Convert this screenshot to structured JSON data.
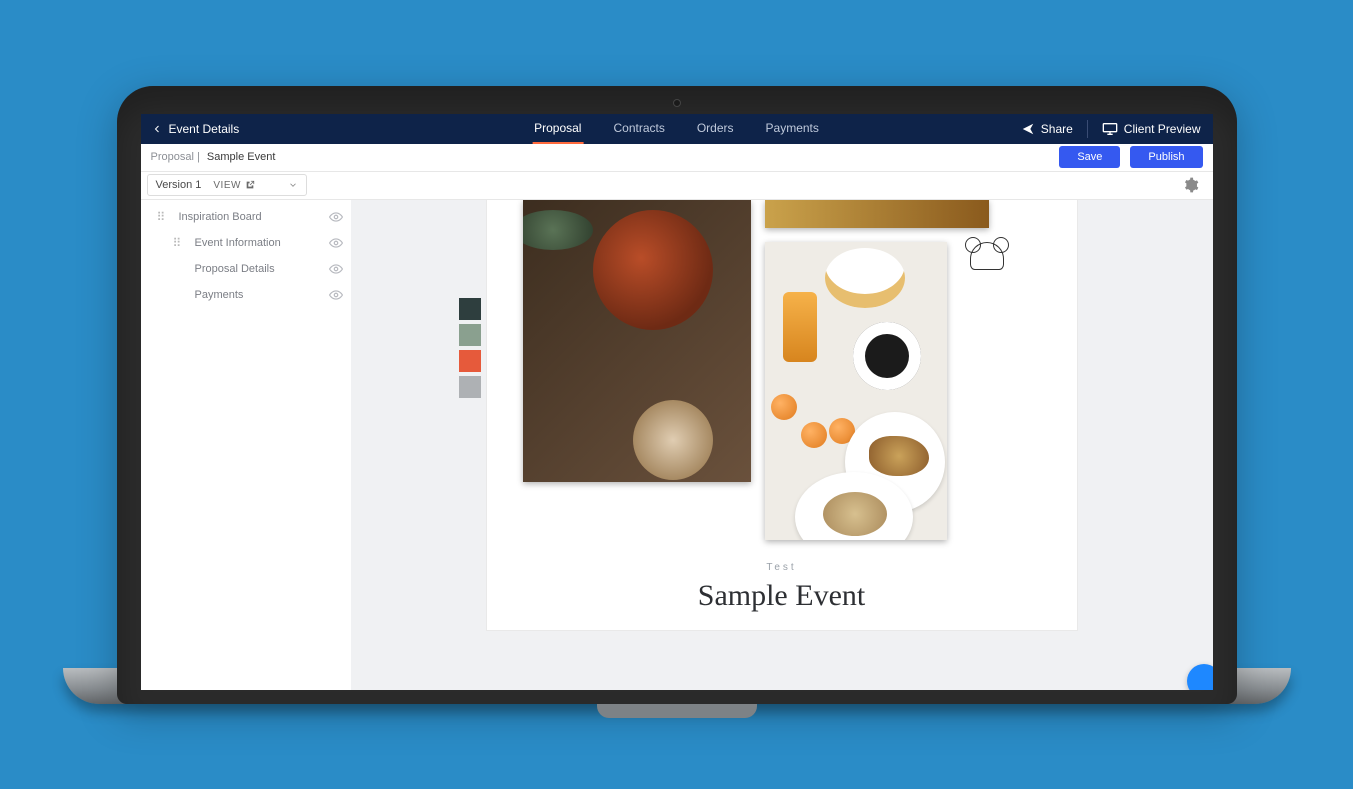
{
  "topbar": {
    "back_label": "Event Details",
    "tabs": [
      {
        "label": "Proposal",
        "active": true
      },
      {
        "label": "Contracts",
        "active": false
      },
      {
        "label": "Orders",
        "active": false
      },
      {
        "label": "Payments",
        "active": false
      }
    ],
    "share_label": "Share",
    "client_preview_label": "Client Preview"
  },
  "subbar": {
    "crumb_root": "Proposal",
    "crumb_current": "Sample Event",
    "save_label": "Save",
    "publish_label": "Publish"
  },
  "version_row": {
    "version_label": "Version 1",
    "view_label": "VIEW"
  },
  "sidebar": {
    "items": [
      {
        "label": "Inspiration Board",
        "draggable": true,
        "visible_toggle": true
      },
      {
        "label": "Event Information",
        "draggable": true,
        "visible_toggle": true
      },
      {
        "label": "Proposal Details",
        "draggable": false,
        "visible_toggle": true
      },
      {
        "label": "Payments",
        "draggable": false,
        "visible_toggle": true
      }
    ]
  },
  "canvas": {
    "swatches": [
      "#2e3e3e",
      "#8aa08f",
      "#e65a3b",
      "#aeb1b4"
    ],
    "logo_caption": "",
    "subcaption": "Test",
    "title": "Sample Event"
  }
}
